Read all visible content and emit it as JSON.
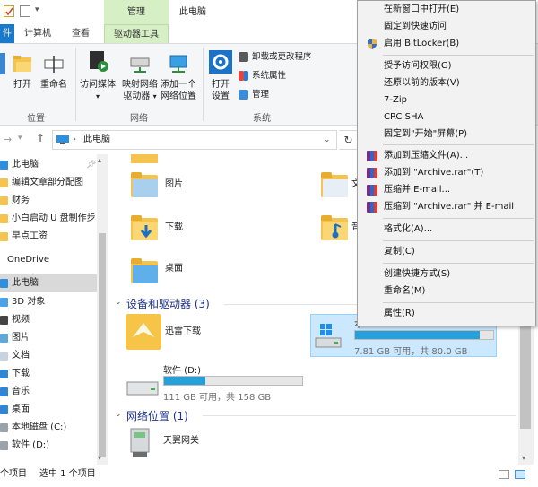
{
  "window": {
    "context_tab_header": "管理",
    "title": "此电脑"
  },
  "ribbon_tabs": {
    "file": "件",
    "computer": "计算机",
    "view": "查看",
    "drive_tools": "驱动器工具"
  },
  "ribbon": {
    "properties": "打开",
    "rename": "重命名",
    "access_media": "访问媒体",
    "map_drive_1": "映射网络",
    "map_drive_2": "驱动器",
    "add_location_1": "添加一个",
    "add_location_2": "网络位置",
    "open_settings_1": "打开",
    "open_settings_2": "设置",
    "uninstall": "卸载或更改程序",
    "system_props": "系统属性",
    "manage": "管理",
    "group_location": "位置",
    "group_network": "网络",
    "group_system": "系统"
  },
  "address": {
    "path": "此电脑"
  },
  "nav": {
    "items": [
      {
        "label": "此电脑"
      },
      {
        "label": "编辑文章部分配图"
      },
      {
        "label": "财务"
      },
      {
        "label": "小白启动 U 盘制作步"
      },
      {
        "label": "早点工资"
      },
      {
        "label": "OneDrive"
      },
      {
        "label": "此电脑"
      },
      {
        "label": "3D 对象"
      },
      {
        "label": "视频"
      },
      {
        "label": "图片"
      },
      {
        "label": "文档"
      },
      {
        "label": "下载"
      },
      {
        "label": "音乐"
      },
      {
        "label": "桌面"
      },
      {
        "label": "本地磁盘 (C:)"
      },
      {
        "label": "软件 (D:)"
      }
    ]
  },
  "content": {
    "folders": {
      "pictures": "图片",
      "downloads": "下载",
      "desktop": "桌面",
      "documents_partial": "文",
      "music_partial": "音"
    },
    "devices_header": "设备和驱动器 (3)",
    "xunlei": "迅雷下载",
    "drive_c": {
      "label": "本",
      "capacity": "7.81 GB 可用，共 80.0 GB",
      "used_fraction": 0.9
    },
    "drive_d": {
      "label": "软件 (D:)",
      "capacity": "111 GB 可用，共 158 GB",
      "used_fraction": 0.3
    },
    "network_header": "网络位置 (1)",
    "tianyi": "天翼网关"
  },
  "status": {
    "items": "个项目",
    "selected": "选中 1 个项目"
  },
  "context_menu": {
    "items": [
      "在新窗口中打开(E)",
      "固定到快速访问",
      "启用 BitLocker(B)",
      "授予访问权限(G)",
      "还原以前的版本(V)",
      "7-Zip",
      "CRC SHA",
      "固定到\"开始\"屏幕(P)",
      "添加到压缩文件(A)...",
      "添加到 \"Archive.rar\"(T)",
      "压缩并 E-mail...",
      "压缩到 \"Archive.rar\" 并 E-mail",
      "格式化(A)...",
      "复制(C)",
      "创建快捷方式(S)",
      "重命名(M)",
      "属性(R)"
    ]
  },
  "colors": {
    "accent": "#1979ca",
    "drive_tools_tab": "#d7efc4",
    "progress": "#26a0da",
    "section_header": "#1e3287",
    "selection": "#cce8ff"
  }
}
